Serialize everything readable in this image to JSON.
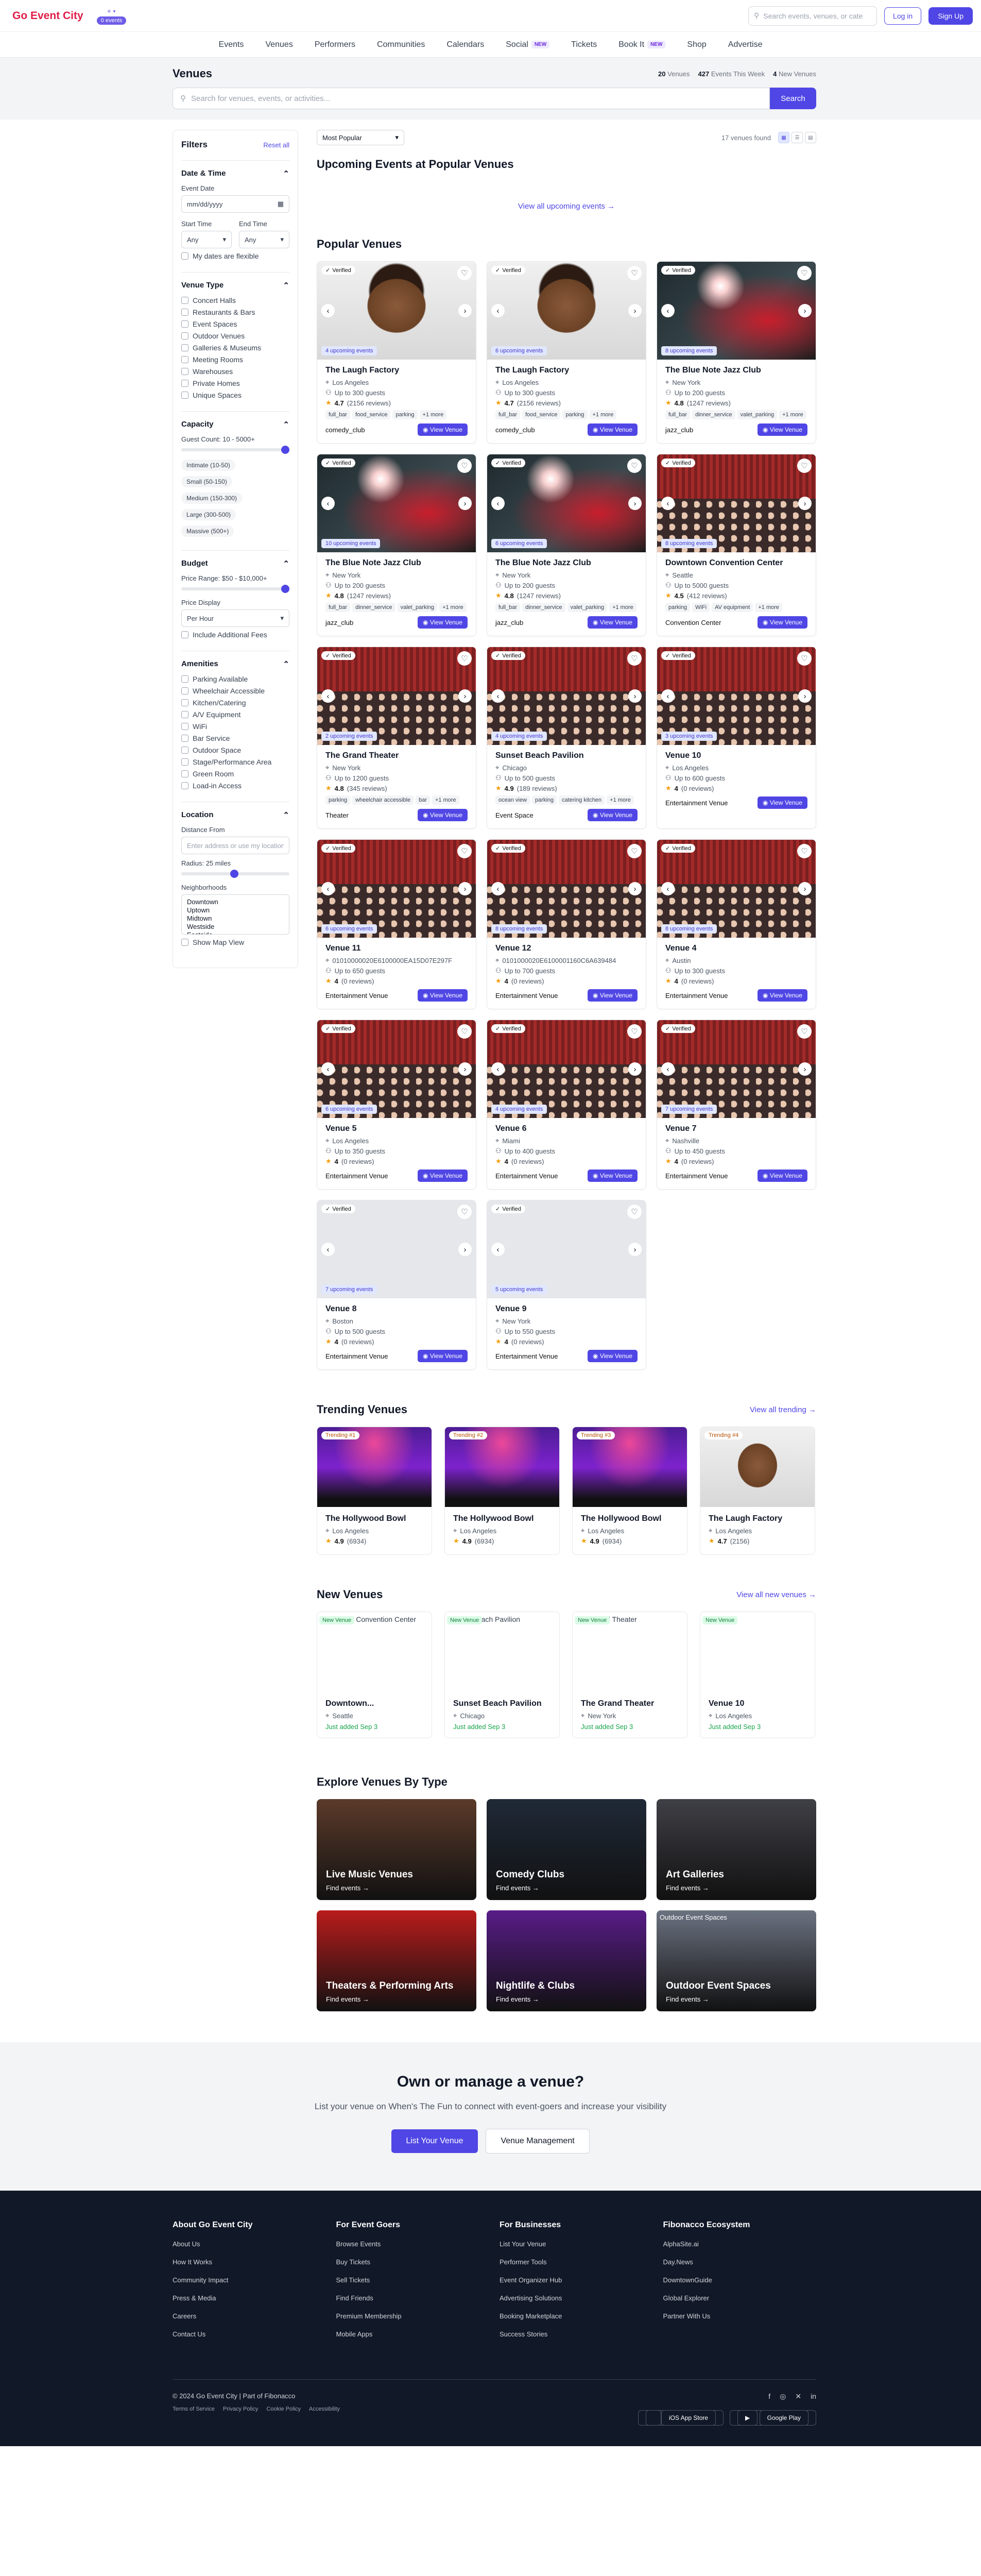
{
  "header": {
    "brand": "Go Event City",
    "events_badge": "0 events",
    "search_placeholder": "Search events, venues, or cate",
    "login": "Log in",
    "signup": "Sign Up"
  },
  "nav": [
    {
      "label": "Events",
      "new": false
    },
    {
      "label": "Venues",
      "new": false
    },
    {
      "label": "Performers",
      "new": false
    },
    {
      "label": "Communities",
      "new": false
    },
    {
      "label": "Calendars",
      "new": false
    },
    {
      "label": "Social",
      "new": true
    },
    {
      "label": "Tickets",
      "new": false
    },
    {
      "label": "Book It",
      "new": true
    },
    {
      "label": "Shop",
      "new": false
    },
    {
      "label": "Advertise",
      "new": false
    }
  ],
  "nav_new_label": "NEW",
  "venues_bar": {
    "title": "Venues",
    "stats": {
      "venues": "20",
      "venues_label": "Venues",
      "events": "427",
      "events_label": "Events This Week",
      "new": "4",
      "new_label": "New Venues"
    },
    "search_placeholder": "Search for venues, events, or activities...",
    "search_button": "Search"
  },
  "filters": {
    "title": "Filters",
    "reset": "Reset all",
    "date_time": {
      "title": "Date & Time",
      "event_date_label": "Event Date",
      "event_date_placeholder": "mm/dd/yyyy",
      "start_label": "Start Time",
      "end_label": "End Time",
      "start_value": "Any",
      "end_value": "Any",
      "flexible": "My dates are flexible"
    },
    "venue_type": {
      "title": "Venue Type",
      "items": [
        "Concert Halls",
        "Restaurants & Bars",
        "Event Spaces",
        "Outdoor Venues",
        "Galleries & Museums",
        "Meeting Rooms",
        "Warehouses",
        "Private Homes",
        "Unique Spaces"
      ]
    },
    "capacity": {
      "title": "Capacity",
      "guest_count": "Guest Count: 10 - 5000+",
      "pills": [
        "Intimate (10-50)",
        "Small (50-150)",
        "Medium (150-300)",
        "Large (300-500)",
        "Massive (500+)"
      ]
    },
    "budget": {
      "title": "Budget",
      "range": "Price Range: $50 - $10,000+",
      "price_display_label": "Price Display",
      "price_display": "Per Hour",
      "fees": "Include Additional Fees"
    },
    "amenities": {
      "title": "Amenities",
      "items": [
        "Parking Available",
        "Wheelchair Accessible",
        "Kitchen/Catering",
        "A/V Equipment",
        "WiFi",
        "Bar Service",
        "Outdoor Space",
        "Stage/Performance Area",
        "Green Room",
        "Load-in Access"
      ]
    },
    "location": {
      "title": "Location",
      "distance_label": "Distance From",
      "distance_placeholder": "Enter address or use my location",
      "radius": "Radius: 25 miles",
      "neighborhoods_label": "Neighborhoods",
      "neighborhoods": [
        "Downtown",
        "Uptown",
        "Midtown",
        "Westside",
        "Eastside"
      ],
      "map": "Show Map View"
    }
  },
  "toolbar": {
    "sort": "Most Popular",
    "found": "17 venues found"
  },
  "upcoming": {
    "title": "Upcoming Events at Popular Venues",
    "view_all": "View all upcoming events →"
  },
  "popular": {
    "title": "Popular Venues",
    "view_button": "View Venue",
    "verified": "Verified",
    "venues": [
      {
        "name": "The Laugh Factory",
        "city": "Los Angeles",
        "capacity": "Up to 300 guests",
        "rating": "4.7",
        "reviews": "(2156 reviews)",
        "tags": [
          "full_bar",
          "food_service",
          "parking",
          "+1 more"
        ],
        "type": "comedy_club",
        "upcoming": "4 upcoming events",
        "img": "face",
        "verified": true
      },
      {
        "name": "The Laugh Factory",
        "city": "Los Angeles",
        "capacity": "Up to 300 guests",
        "rating": "4.7",
        "reviews": "(2156 reviews)",
        "tags": [
          "full_bar",
          "food_service",
          "parking",
          "+1 more"
        ],
        "type": "comedy_club",
        "upcoming": "6 upcoming events",
        "img": "face",
        "verified": true
      },
      {
        "name": "The Blue Note Jazz Club",
        "city": "New York",
        "capacity": "Up to 200 guests",
        "rating": "4.8",
        "reviews": "(1247 reviews)",
        "tags": [
          "full_bar",
          "dinner_service",
          "valet_parking",
          "+1 more"
        ],
        "type": "jazz_club",
        "upcoming": "8 upcoming events",
        "img": "concert",
        "verified": true
      },
      {
        "name": "The Blue Note Jazz Club",
        "city": "New York",
        "capacity": "Up to 200 guests",
        "rating": "4.8",
        "reviews": "(1247 reviews)",
        "tags": [
          "full_bar",
          "dinner_service",
          "valet_parking",
          "+1 more"
        ],
        "type": "jazz_club",
        "upcoming": "10 upcoming events",
        "img": "concert",
        "verified": true
      },
      {
        "name": "The Blue Note Jazz Club",
        "city": "New York",
        "capacity": "Up to 200 guests",
        "rating": "4.8",
        "reviews": "(1247 reviews)",
        "tags": [
          "full_bar",
          "dinner_service",
          "valet_parking",
          "+1 more"
        ],
        "type": "jazz_club",
        "upcoming": "6 upcoming events",
        "img": "concert",
        "verified": true
      },
      {
        "name": "Downtown Convention Center",
        "city": "Seattle",
        "capacity": "Up to 5000 guests",
        "rating": "4.5",
        "reviews": "(412 reviews)",
        "tags": [
          "parking",
          "WiFi",
          "AV equipment",
          "+1 more"
        ],
        "type": "Convention Center",
        "upcoming": "8 upcoming events",
        "img": "theater",
        "verified": true
      },
      {
        "name": "The Grand Theater",
        "city": "New York",
        "capacity": "Up to 1200 guests",
        "rating": "4.8",
        "reviews": "(345 reviews)",
        "tags": [
          "parking",
          "wheelchair accessible",
          "bar",
          "+1 more"
        ],
        "type": "Theater",
        "upcoming": "2 upcoming events",
        "img": "theater",
        "verified": true
      },
      {
        "name": "Sunset Beach Pavilion",
        "city": "Chicago",
        "capacity": "Up to 500 guests",
        "rating": "4.9",
        "reviews": "(189 reviews)",
        "tags": [
          "ocean view",
          "parking",
          "catering kitchen",
          "+1 more"
        ],
        "type": "Event Space",
        "upcoming": "4 upcoming events",
        "img": "theater",
        "verified": true
      },
      {
        "name": "Venue 10",
        "city": "Los Angeles",
        "capacity": "Up to 600 guests",
        "rating": "4",
        "reviews": "(0 reviews)",
        "tags": [],
        "type": "Entertainment Venue",
        "upcoming": "3 upcoming events",
        "img": "theater",
        "verified": true
      },
      {
        "name": "Venue 11",
        "city": "01010000020E6100000EA15D07E297F",
        "capacity": "Up to 650 guests",
        "rating": "4",
        "reviews": "(0 reviews)",
        "tags": [],
        "type": "Entertainment Venue",
        "upcoming": "6 upcoming events",
        "img": "theater",
        "verified": true
      },
      {
        "name": "Venue 12",
        "city": "0101000020E6100001160C6A639484",
        "capacity": "Up to 700 guests",
        "rating": "4",
        "reviews": "(0 reviews)",
        "tags": [],
        "type": "Entertainment Venue",
        "upcoming": "8 upcoming events",
        "img": "theater",
        "verified": true
      },
      {
        "name": "Venue 4",
        "city": "Austin",
        "capacity": "Up to 300 guests",
        "rating": "4",
        "reviews": "(0 reviews)",
        "tags": [],
        "type": "Entertainment Venue",
        "upcoming": "8 upcoming events",
        "img": "theater",
        "verified": true
      },
      {
        "name": "Venue 5",
        "city": "Los Angeles",
        "capacity": "Up to 350 guests",
        "rating": "4",
        "reviews": "(0 reviews)",
        "tags": [],
        "type": "Entertainment Venue",
        "upcoming": "6 upcoming events",
        "img": "theater",
        "verified": true
      },
      {
        "name": "Venue 6",
        "city": "Miami",
        "capacity": "Up to 400 guests",
        "rating": "4",
        "reviews": "(0 reviews)",
        "tags": [],
        "type": "Entertainment Venue",
        "upcoming": "4 upcoming events",
        "img": "theater",
        "verified": true
      },
      {
        "name": "Venue 7",
        "city": "Nashville",
        "capacity": "Up to 450 guests",
        "rating": "4",
        "reviews": "(0 reviews)",
        "tags": [],
        "type": "Entertainment Venue",
        "upcoming": "7 upcoming events",
        "img": "theater",
        "verified": true
      },
      {
        "name": "Venue 8",
        "city": "Boston",
        "capacity": "Up to 500 guests",
        "rating": "4",
        "reviews": "(0 reviews)",
        "tags": [],
        "type": "Entertainment Venue",
        "upcoming": "7 upcoming events",
        "img": "blank",
        "verified": true
      },
      {
        "name": "Venue 9",
        "city": "New York",
        "capacity": "Up to 550 guests",
        "rating": "4",
        "reviews": "(0 reviews)",
        "tags": [],
        "type": "Entertainment Venue",
        "upcoming": "5 upcoming events",
        "img": "blank",
        "verified": true
      }
    ]
  },
  "trending": {
    "title": "Trending Venues",
    "view_all": "View all trending →",
    "items": [
      {
        "badge": "Trending #1",
        "name": "The Hollywood Bowl",
        "city": "Los Angeles",
        "rating": "4.9",
        "count": "(6934)",
        "img": "concert"
      },
      {
        "badge": "Trending #2",
        "name": "The Hollywood Bowl",
        "city": "Los Angeles",
        "rating": "4.9",
        "count": "(6934)",
        "img": "concert"
      },
      {
        "badge": "Trending #3",
        "name": "The Hollywood Bowl",
        "city": "Los Angeles",
        "rating": "4.9",
        "count": "(6934)",
        "img": "concert"
      },
      {
        "badge": "Trending #4",
        "name": "The Laugh Factory",
        "city": "Los Angeles",
        "rating": "4.7",
        "count": "(2156)",
        "img": "face"
      }
    ]
  },
  "new_venues": {
    "title": "New Venues",
    "view_all": "View all new venues →",
    "badge": "New Venue",
    "items": [
      {
        "alt": "Downtown Convention Center",
        "name": "Downtown...",
        "city": "Seattle",
        "added": "Just added Sep 3"
      },
      {
        "alt": "Sunset Beach Pavilion",
        "name": "Sunset Beach Pavilion",
        "city": "Chicago",
        "added": "Just added Sep 3"
      },
      {
        "alt": "The Grand Theater",
        "name": "The Grand Theater",
        "city": "New York",
        "added": "Just added Sep 3"
      },
      {
        "alt": "Venue 10",
        "name": "Venue 10",
        "city": "Los Angeles",
        "added": "Just added Sep 3"
      }
    ]
  },
  "types": {
    "title": "Explore Venues By Type",
    "find": "Find events →",
    "items": [
      {
        "name": "Live Music Venues",
        "bg": "#5b3a2a"
      },
      {
        "name": "Comedy Clubs",
        "bg": "#1f2937"
      },
      {
        "name": "Art Galleries",
        "bg": "#3f3f46"
      },
      {
        "name": "Theaters & Performing Arts",
        "bg": "#b91c1c"
      },
      {
        "name": "Nightlife & Clubs",
        "bg": "#581c87"
      },
      {
        "name": "Outdoor Event Spaces",
        "bg": "#6b7280",
        "alt": "Outdoor Event Spaces"
      }
    ]
  },
  "cta": {
    "title": "Own or manage a venue?",
    "text": "List your venue on When's The Fun to connect with event-goers and increase your visibility",
    "primary": "List Your Venue",
    "secondary": "Venue Management"
  },
  "footer": {
    "cols": [
      {
        "title": "About Go Event City",
        "links": [
          "About Us",
          "How It Works",
          "Community Impact",
          "Press & Media",
          "Careers",
          "Contact Us"
        ]
      },
      {
        "title": "For Event Goers",
        "links": [
          "Browse Events",
          "Buy Tickets",
          "Sell Tickets",
          "Find Friends",
          "Premium Membership",
          "Mobile Apps"
        ]
      },
      {
        "title": "For Businesses",
        "links": [
          "List Your Venue",
          "Performer Tools",
          "Event Organizer Hub",
          "Advertising Solutions",
          "Booking Marketplace",
          "Success Stories"
        ]
      },
      {
        "title": "Fibonacco Ecosystem",
        "links": [
          "AlphaSite.ai",
          "Day.News",
          "DowntownGuide",
          "Global Explorer",
          "Partner With Us"
        ]
      }
    ],
    "copyright": "© 2024 Go Event City | Part of Fibonacco",
    "legal": [
      "Terms of Service",
      "Privacy Policy",
      "Cookie Policy",
      "Accessibility"
    ],
    "ios": "iOS App Store",
    "android": "Google Play"
  }
}
